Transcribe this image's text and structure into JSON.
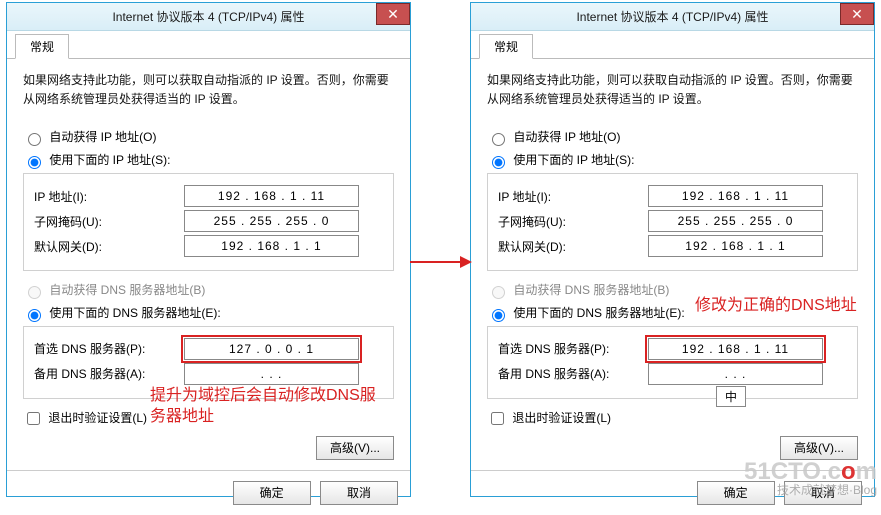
{
  "title": "Internet 协议版本 4 (TCP/IPv4) 属性",
  "tab_general": "常规",
  "desc": "如果网络支持此功能，则可以获取自动指派的 IP 设置。否则，你需要从网络系统管理员处获得适当的 IP 设置。",
  "radio_auto_ip": "自动获得 IP 地址(O)",
  "radio_manual_ip": "使用下面的 IP 地址(S):",
  "label_ip": "IP 地址(I):",
  "label_mask": "子网掩码(U):",
  "label_gateway": "默认网关(D):",
  "radio_auto_dns": "自动获得 DNS 服务器地址(B)",
  "radio_manual_dns": "使用下面的 DNS 服务器地址(E):",
  "label_dns_primary": "首选 DNS 服务器(P):",
  "label_dns_alt": "备用 DNS 服务器(A):",
  "chk_validate": "退出时验证设置(L)",
  "btn_advanced": "高级(V)...",
  "btn_ok": "确定",
  "btn_cancel": "取消",
  "left": {
    "ip": "192 . 168 .  1  . 11",
    "mask": "255 . 255 . 255 .  0",
    "gateway": "192 . 168 .  1  .  1",
    "dns1": "127 .  0  .  0  .  1",
    "dns2": " .     .     . "
  },
  "right": {
    "ip": "192 . 168 .  1  . 11",
    "mask": "255 . 255 . 255 .  0",
    "gateway": "192 . 168 .  1  .  1",
    "dns1": "192 . 168 .  1  . 11",
    "dns2": " .     .     . ",
    "ime": "中"
  },
  "anno_left": "提升为域控后会自动修改DNS服务器地址",
  "anno_right": "修改为正确的DNS地址",
  "watermark": {
    "site": "51CTO.c",
    "o": "o",
    "m": "m",
    "sub": "技术成就梦想·Blog"
  }
}
